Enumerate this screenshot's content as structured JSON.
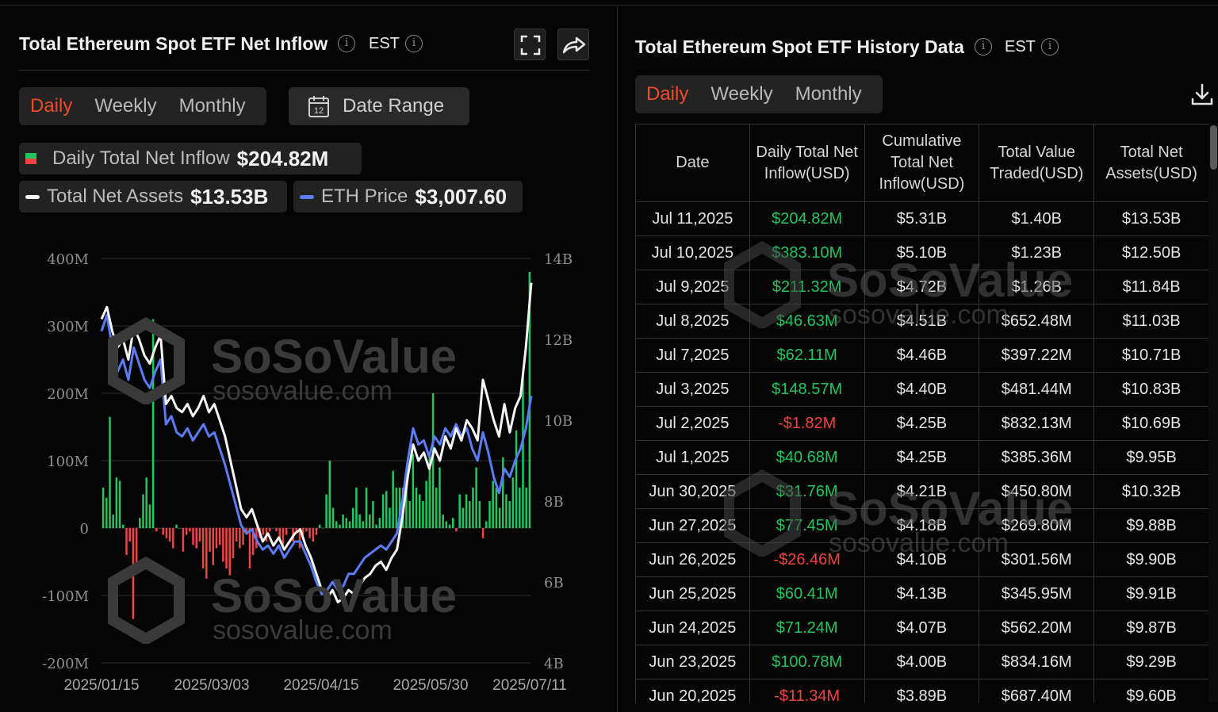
{
  "left": {
    "title": "Total Ethereum Spot ETF Net Inflow",
    "timezone": "EST",
    "tabs": [
      {
        "label": "Daily",
        "active": true
      },
      {
        "label": "Weekly",
        "active": false
      },
      {
        "label": "Monthly",
        "active": false
      }
    ],
    "date_range_label": "Date Range",
    "calendar_day": "12",
    "legend": {
      "net_inflow_label": "Daily Total Net Inflow",
      "net_inflow_value": "$204.82M",
      "net_assets_label": "Total Net Assets",
      "net_assets_value": "$13.53B",
      "eth_price_label": "ETH Price",
      "eth_price_value": "$3,007.60"
    }
  },
  "watermark": {
    "brand": "SoSoValue",
    "domain": "sosovalue.com"
  },
  "colors": {
    "positive": "#22c55e",
    "negative": "#ef4444",
    "active_tab": "#ee4b2b",
    "eth_line": "#5b7cf5",
    "assets_line": "#f5f5f5"
  },
  "chart_data": {
    "type": "bar",
    "x_ticks": [
      "2025/01/15",
      "2025/03/03",
      "2025/04/15",
      "2025/05/30",
      "2025/07/11"
    ],
    "y_left_ticks": [
      "400M",
      "300M",
      "200M",
      "100M",
      "0",
      "-100M",
      "-200M"
    ],
    "y_left_range": [
      -200,
      400
    ],
    "y_left_unit": "M",
    "y_right_ticks": [
      "14B",
      "12B",
      "10B",
      "8B",
      "6B",
      "4B"
    ],
    "y_right_range": [
      4,
      14
    ],
    "y_right_unit": "B",
    "grid": true,
    "series": [
      {
        "name": "Daily Total Net Inflow",
        "kind": "bar",
        "axis": "left",
        "values": [
          60,
          45,
          165,
          20,
          75,
          70,
          5,
          -40,
          -20,
          -135,
          -55,
          15,
          50,
          75,
          35,
          310,
          -5,
          0,
          -10,
          -15,
          -20,
          -30,
          5,
          0,
          -35,
          -10,
          -5,
          -25,
          -30,
          -20,
          -60,
          -75,
          -35,
          -55,
          -30,
          -25,
          -50,
          -60,
          -70,
          -45,
          -20,
          -30,
          -25,
          -10,
          -60,
          -40,
          -30,
          -15,
          -10,
          -20,
          -5,
          0,
          -5,
          -15,
          -25,
          -10,
          0,
          -20,
          -5,
          -30,
          -10,
          -5,
          -15,
          -20,
          -10,
          5,
          0,
          50,
          100,
          30,
          10,
          5,
          20,
          15,
          10,
          30,
          60,
          20,
          10,
          60,
          20,
          40,
          5,
          15,
          50,
          55,
          30,
          85,
          60,
          60,
          60,
          70,
          40,
          110,
          60,
          50,
          40,
          70,
          105,
          200,
          60,
          90,
          20,
          10,
          5,
          15,
          -5,
          50,
          30,
          50,
          40,
          60,
          90,
          40,
          -15,
          10,
          40,
          70,
          60,
          30,
          105,
          50,
          40,
          75,
          145,
          60,
          225,
          60,
          380
        ]
      },
      {
        "name": "Total Net Assets",
        "kind": "line",
        "axis": "right",
        "values": [
          12.5,
          12.8,
          12.2,
          11.8,
          12.0,
          11.5,
          12.3,
          12.0,
          11.6,
          11.4,
          11.8,
          12.1,
          10.4,
          10.6,
          10.3,
          10.2,
          10.4,
          10.1,
          10.3,
          10.6,
          10.2,
          10.4,
          10.0,
          9.6,
          9.0,
          8.4,
          7.8,
          7.6,
          7.8,
          7.4,
          7.0,
          7.2,
          6.9,
          7.1,
          6.8,
          7.0,
          7.2,
          7.3,
          6.9,
          6.6,
          6.2,
          5.8,
          5.6,
          5.8,
          5.5,
          5.6,
          5.8,
          5.7,
          5.9,
          6.1,
          6.2,
          6.4,
          6.5,
          6.3,
          6.6,
          6.8,
          7.6,
          8.6,
          9.4,
          9.0,
          9.2,
          8.8,
          9.3,
          9.0,
          9.6,
          9.3,
          9.8,
          9.5,
          10.0,
          9.8,
          9.5,
          11.0,
          10.5,
          10.0,
          9.6,
          10.4,
          9.7,
          10.3,
          10.6,
          11.8,
          13.4
        ]
      },
      {
        "name": "ETH Price",
        "kind": "line",
        "axis": "right",
        "values": [
          12.2,
          12.6,
          11.8,
          11.2,
          11.5,
          11.0,
          11.8,
          11.4,
          11.0,
          10.8,
          11.2,
          11.5,
          9.9,
          10.1,
          9.7,
          9.6,
          9.8,
          9.5,
          9.7,
          9.9,
          9.6,
          9.7,
          9.3,
          8.9,
          8.4,
          7.9,
          7.4,
          7.2,
          7.3,
          7.0,
          6.8,
          6.9,
          6.7,
          6.9,
          6.6,
          6.8,
          7.0,
          7.0,
          6.7,
          6.4,
          6.0,
          5.7,
          5.8,
          6.0,
          5.8,
          5.9,
          6.2,
          6.2,
          6.4,
          6.6,
          6.7,
          6.8,
          6.9,
          6.8,
          7.0,
          7.2,
          8.0,
          9.0,
          9.8,
          9.4,
          9.5,
          9.1,
          9.6,
          9.4,
          9.8,
          9.6,
          9.9,
          9.6,
          9.8,
          9.3,
          9.0,
          9.7,
          9.2,
          8.6,
          8.2,
          8.8,
          8.6,
          9.0,
          9.3,
          9.8,
          10.6
        ]
      }
    ]
  },
  "right": {
    "title": "Total Ethereum Spot ETF History Data",
    "timezone": "EST",
    "tabs": [
      {
        "label": "Daily",
        "active": true
      },
      {
        "label": "Weekly",
        "active": false
      },
      {
        "label": "Monthly",
        "active": false
      }
    ],
    "columns": [
      "Date",
      "Daily Total Net Inflow(USD)",
      "Cumulative Total Net Inflow(USD)",
      "Total Value Traded(USD)",
      "Total Net Assets(USD)"
    ],
    "rows": [
      [
        "Jul 11,2025",
        "$204.82M",
        "$5.31B",
        "$1.40B",
        "$13.53B"
      ],
      [
        "Jul 10,2025",
        "$383.10M",
        "$5.10B",
        "$1.23B",
        "$12.50B"
      ],
      [
        "Jul 9,2025",
        "$211.32M",
        "$4.72B",
        "$1.26B",
        "$11.84B"
      ],
      [
        "Jul 8,2025",
        "$46.63M",
        "$4.51B",
        "$652.48M",
        "$11.03B"
      ],
      [
        "Jul 7,2025",
        "$62.11M",
        "$4.46B",
        "$397.22M",
        "$10.71B"
      ],
      [
        "Jul 3,2025",
        "$148.57M",
        "$4.40B",
        "$481.44M",
        "$10.83B"
      ],
      [
        "Jul 2,2025",
        "-$1.82M",
        "$4.25B",
        "$832.13M",
        "$10.69B"
      ],
      [
        "Jul 1,2025",
        "$40.68M",
        "$4.25B",
        "$385.36M",
        "$9.95B"
      ],
      [
        "Jun 30,2025",
        "$31.76M",
        "$4.21B",
        "$450.80M",
        "$10.32B"
      ],
      [
        "Jun 27,2025",
        "$77.45M",
        "$4.18B",
        "$269.80M",
        "$9.88B"
      ],
      [
        "Jun 26,2025",
        "-$26.46M",
        "$4.10B",
        "$301.56M",
        "$9.90B"
      ],
      [
        "Jun 25,2025",
        "$60.41M",
        "$4.13B",
        "$345.95M",
        "$9.91B"
      ],
      [
        "Jun 24,2025",
        "$71.24M",
        "$4.07B",
        "$562.20M",
        "$9.87B"
      ],
      [
        "Jun 23,2025",
        "$100.78M",
        "$4.00B",
        "$834.16M",
        "$9.29B"
      ],
      [
        "Jun 20,2025",
        "-$11.34M",
        "$3.89B",
        "$687.40M",
        "$9.60B"
      ]
    ]
  }
}
